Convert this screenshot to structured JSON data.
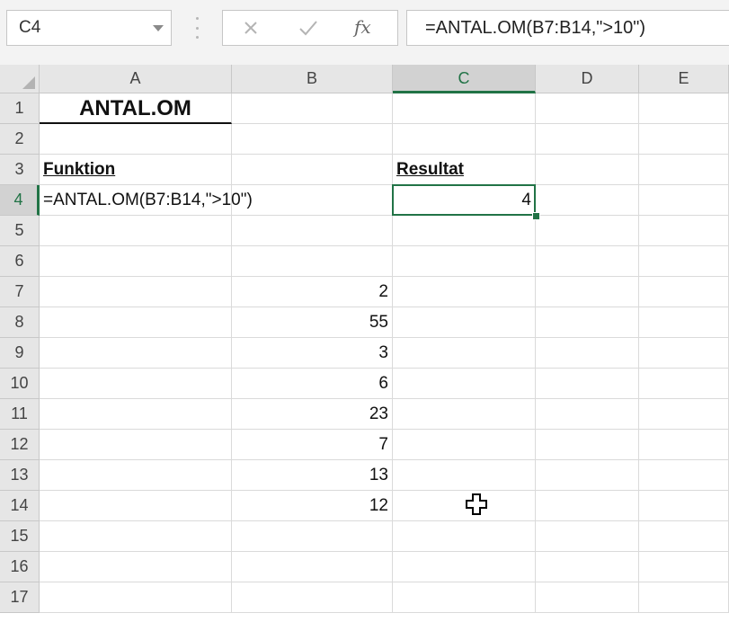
{
  "name_box": {
    "value": "C4"
  },
  "formula_bar": {
    "fx_label": "fx",
    "formula": "=ANTAL.OM(B7:B14,\">10\")"
  },
  "columns": [
    "A",
    "B",
    "C",
    "D",
    "E"
  ],
  "rows": [
    "1",
    "2",
    "3",
    "4",
    "5",
    "6",
    "7",
    "8",
    "9",
    "10",
    "11",
    "12",
    "13",
    "14",
    "15",
    "16",
    "17"
  ],
  "active_cell": {
    "column": "C",
    "row": "4"
  },
  "sheet": {
    "title": "ANTAL.OM",
    "function_heading": "Funktion",
    "result_heading": "Resultat",
    "formula_text": "=ANTAL.OM(B7:B14,\">10\")",
    "result_value": "4",
    "values": [
      "2",
      "55",
      "3",
      "6",
      "23",
      "7",
      "13",
      "12"
    ]
  },
  "colors": {
    "accent": "#217346",
    "header_bg": "#e6e6e6",
    "grid_line": "#dadada"
  },
  "icons": [
    "cancel-icon",
    "enter-icon",
    "insert-function-icon",
    "fill-cursor-icon"
  ]
}
